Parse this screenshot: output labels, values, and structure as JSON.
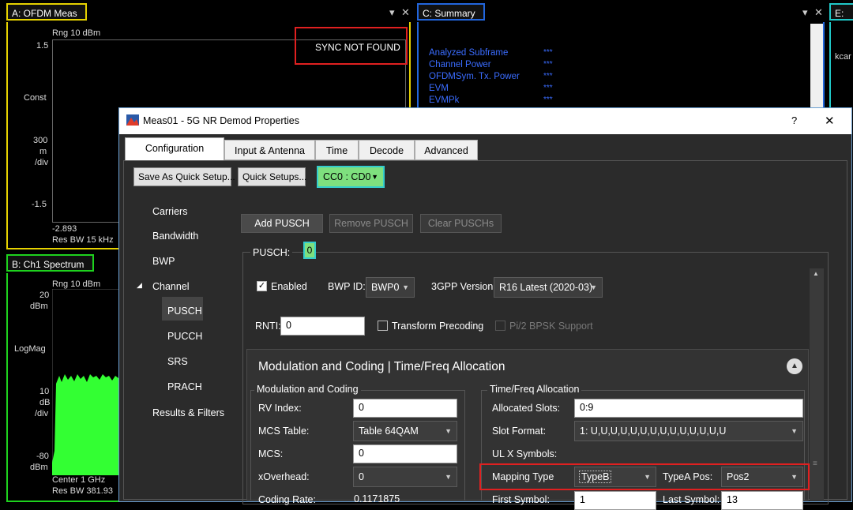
{
  "panes": {
    "a": {
      "title": "A: OFDM Meas",
      "scale": "Rng 10 dBm",
      "y_top": "1.5",
      "y_label": "Const",
      "y_div1": "300",
      "y_div2": "m",
      "y_div3": "/div",
      "y_bottom": "-1.5",
      "x_start": "-2.893",
      "res_bw": "Res BW 15 kHz",
      "sync_msg": "SYNC NOT FOUND",
      "color": "#e6d200"
    },
    "b": {
      "title": "B: Ch1 Spectrum",
      "scale": "Rng 10 dBm",
      "y_top1": "20",
      "y_top2": "dBm",
      "y_label": "LogMag",
      "y_div1": "10",
      "y_div2": "dB",
      "y_div3": "/div",
      "y_bottom1": "-80",
      "y_bottom2": "dBm",
      "center": "Center 1 GHz",
      "res_bw": "Res BW 381.93",
      "color": "#1ed21e"
    },
    "c": {
      "title": "C: Summary",
      "color": "#2266dd",
      "rows": [
        {
          "label": "Analyzed  Subframe",
          "value": "***"
        },
        {
          "label": "Channel  Power",
          "value": "***"
        },
        {
          "label": "OFDMSym. Tx.  Power",
          "value": "***"
        },
        {
          "label": "EVM",
          "value": "***"
        },
        {
          "label": "EVMPk",
          "value": "***"
        }
      ]
    },
    "e": {
      "title": "E: OF",
      "text": "kcar",
      "color": "#20c8c8"
    },
    "controls": {
      "pin": "▾",
      "close": "✕"
    }
  },
  "dialog": {
    "title": "Meas01 - 5G NR Demod Properties",
    "help": "?",
    "close": "✕",
    "tabs": [
      "Configuration",
      "Input & Antenna",
      "Time",
      "Decode",
      "Advanced"
    ],
    "save_quick": "Save As Quick Setup...",
    "quick_setups": "Quick Setups...",
    "cc_select": "CC0 : CD0",
    "nav": [
      "Carriers",
      "Bandwidth",
      "BWP",
      "Channel",
      "PUSCH",
      "PUCCH",
      "SRS",
      "PRACH",
      "Results & Filters"
    ],
    "add_pusch": "Add PUSCH",
    "remove_pusch": "Remove PUSCH",
    "clear_puschs": "Clear PUSCHs",
    "pusch_label": "PUSCH:",
    "pusch_index": "0",
    "enabled_label": "Enabled",
    "bwp_id_label": "BWP ID:",
    "bwp_id_value": "BWP0",
    "gpp_label": "3GPP Version:",
    "gpp_value": "R16 Latest (2020-03)",
    "rnti_label": "RNTI:",
    "rnti_value": "0",
    "transform_precoding": "Transform Precoding",
    "pi2_bpsk": "Pi/2 BPSK Support",
    "section_title": "Modulation and Coding | Time/Freq Allocation",
    "mod_group": "Modulation and Coding",
    "rv_label": "RV Index:",
    "rv_value": "0",
    "mcs_table_label": "MCS Table:",
    "mcs_table_value": "Table 64QAM",
    "mcs_label": "MCS:",
    "mcs_value": "0",
    "xoverhead_label": "xOverhead:",
    "xoverhead_value": "0",
    "coding_rate_label": "Coding Rate:",
    "coding_rate_value": "0.1171875",
    "tf_group": "Time/Freq Allocation",
    "alloc_slots_label": "Allocated Slots:",
    "alloc_slots_value": "0:9",
    "slot_format_label": "Slot Format:",
    "slot_format_value": "1: U,U,U,U,U,U,U,U,U,U,U,U,U,U",
    "ulx_label": "UL X Symbols:",
    "mapping_type_label": "Mapping Type",
    "mapping_type_value": "TypeB",
    "typea_pos_label": "TypeA Pos:",
    "typea_pos_value": "Pos2",
    "first_symbol_label": "First Symbol:",
    "first_symbol_value": "1",
    "last_symbol_label": "Last Symbol:",
    "last_symbol_value": "13"
  }
}
